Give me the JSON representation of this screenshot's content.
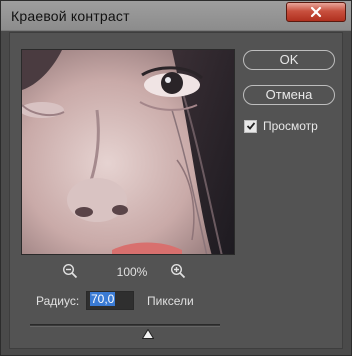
{
  "window": {
    "title": "Краевой контраст"
  },
  "buttons": {
    "ok_label": "OK",
    "cancel_label": "Отмена"
  },
  "preview_checkbox": {
    "label": "Просмотр",
    "checked": true
  },
  "zoom": {
    "level": "100%"
  },
  "radius": {
    "label": "Радиус:",
    "value": "70,0",
    "units": "Пиксели"
  },
  "slider": {
    "value_fraction": 0.62
  },
  "colors": {
    "dialog_bg": "#535353",
    "titlebar": "#8c8c8c",
    "close_button": "#c8503e",
    "selection": "#3a7bd5"
  },
  "icons": {
    "close": "close-icon",
    "zoom_out": "zoom-out-icon",
    "zoom_in": "zoom-in-icon",
    "check": "checkmark-icon",
    "slider": "slider-thumb-icon"
  }
}
